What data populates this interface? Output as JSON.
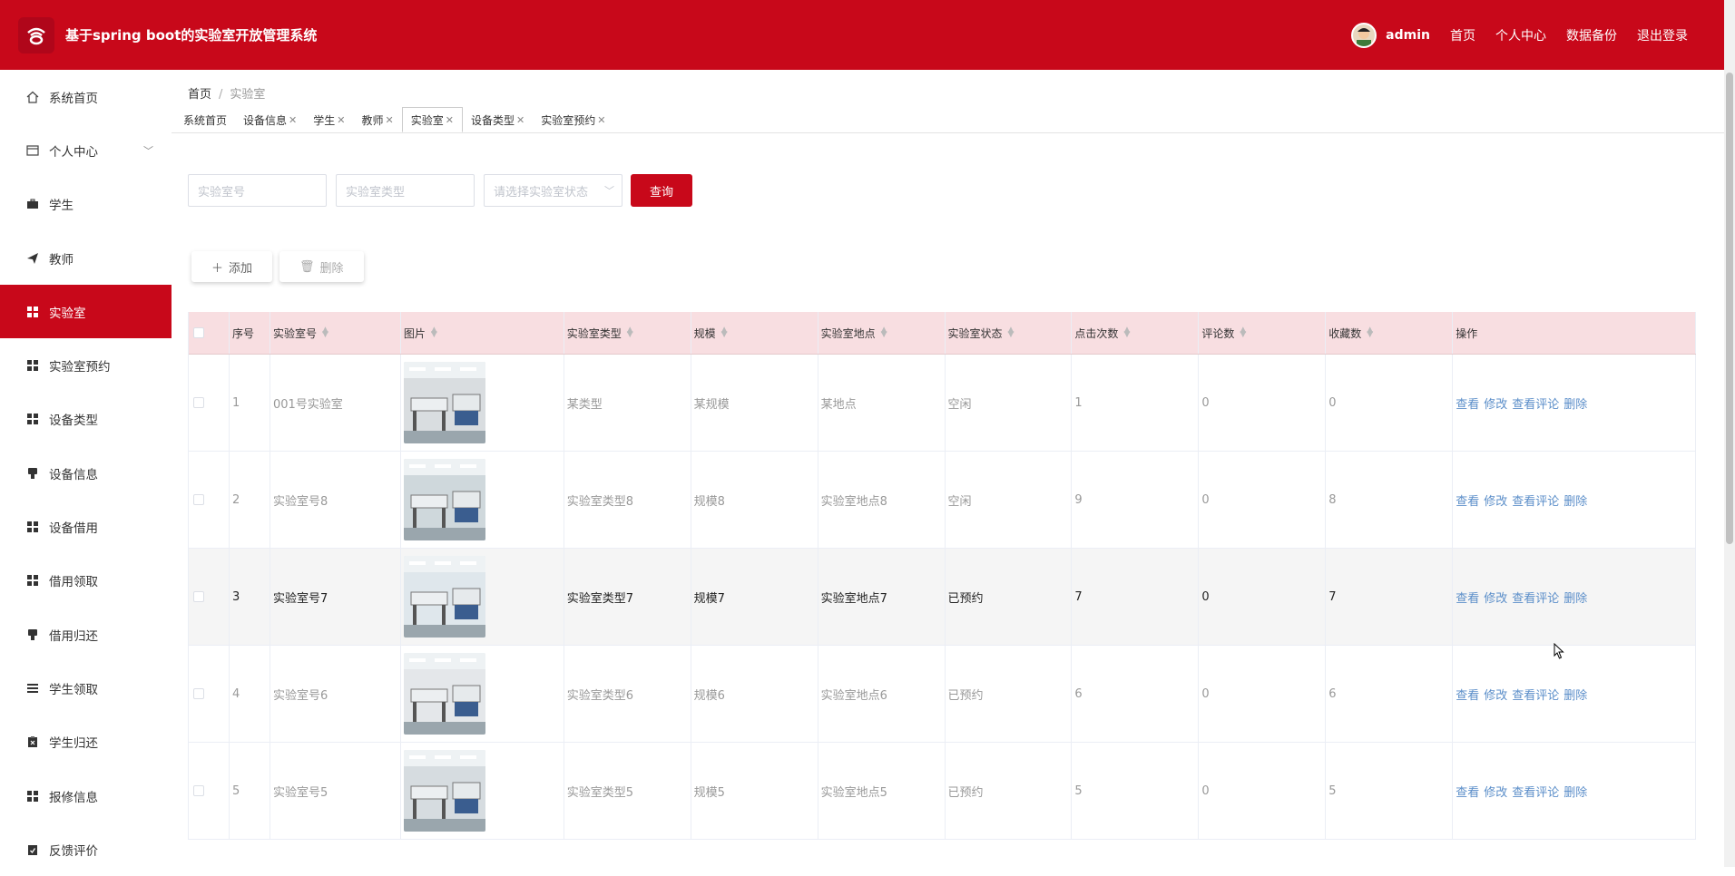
{
  "header": {
    "title": "基于spring boot的实验室开放管理系统",
    "user": "admin",
    "links": [
      "首页",
      "个人中心",
      "数据备份",
      "退出登录"
    ]
  },
  "sidebar": {
    "items": [
      {
        "label": "系统首页",
        "icon": "home-icon"
      },
      {
        "label": "个人中心",
        "icon": "profile-card-icon"
      },
      {
        "label": "学生",
        "icon": "briefcase-icon"
      },
      {
        "label": "教师",
        "icon": "send-icon"
      },
      {
        "label": "实验室",
        "icon": "grid-icon"
      },
      {
        "label": "实验室预约",
        "icon": "grid-icon"
      },
      {
        "label": "设备类型",
        "icon": "grid-icon"
      },
      {
        "label": "设备信息",
        "icon": "stamp-icon"
      },
      {
        "label": "设备借用",
        "icon": "grid-icon"
      },
      {
        "label": "借用领取",
        "icon": "grid-icon"
      },
      {
        "label": "借用归还",
        "icon": "stamp-icon"
      },
      {
        "label": "学生领取",
        "icon": "list-icon"
      },
      {
        "label": "学生归还",
        "icon": "clipboard-icon"
      },
      {
        "label": "报修信息",
        "icon": "grid-icon"
      },
      {
        "label": "反馈评价",
        "icon": "check-clipboard-icon"
      }
    ]
  },
  "breadcrumb": {
    "home": "首页",
    "separator": "/",
    "current": "实验室"
  },
  "tabs": [
    {
      "label": "系统首页",
      "closable": false
    },
    {
      "label": "设备信息",
      "closable": true
    },
    {
      "label": "学生",
      "closable": true
    },
    {
      "label": "教师",
      "closable": true
    },
    {
      "label": "实验室",
      "closable": true
    },
    {
      "label": "设备类型",
      "closable": true
    },
    {
      "label": "实验室预约",
      "closable": true
    }
  ],
  "search": {
    "lab_no_placeholder": "实验室号",
    "lab_type_placeholder": "实验室类型",
    "status_placeholder": "请选择实验室状态",
    "query_label": "查询"
  },
  "toolbar": {
    "add_label": "添加",
    "delete_label": "删除"
  },
  "table": {
    "headers": [
      "序号",
      "实验室号",
      "图片",
      "实验室类型",
      "规模",
      "实验室地点",
      "实验室状态",
      "点击次数",
      "评论数",
      "收藏数",
      "操作"
    ],
    "actions": [
      "查看",
      "修改",
      "查看评论",
      "删除"
    ],
    "rows": [
      {
        "index": "1",
        "lab_no": "001号实验室",
        "type": "某类型",
        "scale": "某规模",
        "location": "某地点",
        "status": "空闲",
        "clicks": "1",
        "comments": "0",
        "favorites": "0"
      },
      {
        "index": "2",
        "lab_no": "实验室号8",
        "type": "实验室类型8",
        "scale": "规模8",
        "location": "实验室地点8",
        "status": "空闲",
        "clicks": "9",
        "comments": "0",
        "favorites": "8"
      },
      {
        "index": "3",
        "lab_no": "实验室号7",
        "type": "实验室类型7",
        "scale": "规模7",
        "location": "实验室地点7",
        "status": "已预约",
        "clicks": "7",
        "comments": "0",
        "favorites": "7"
      },
      {
        "index": "4",
        "lab_no": "实验室号6",
        "type": "实验室类型6",
        "scale": "规模6",
        "location": "实验室地点6",
        "status": "已预约",
        "clicks": "6",
        "comments": "0",
        "favorites": "6"
      },
      {
        "index": "5",
        "lab_no": "实验室号5",
        "type": "实验室类型5",
        "scale": "规模5",
        "location": "实验室地点5",
        "status": "已预约",
        "clicks": "5",
        "comments": "0",
        "favorites": "5"
      }
    ]
  },
  "colors": {
    "brand": "#c8081a",
    "header_row": "#f8dee1",
    "link": "#5b8ec9"
  }
}
